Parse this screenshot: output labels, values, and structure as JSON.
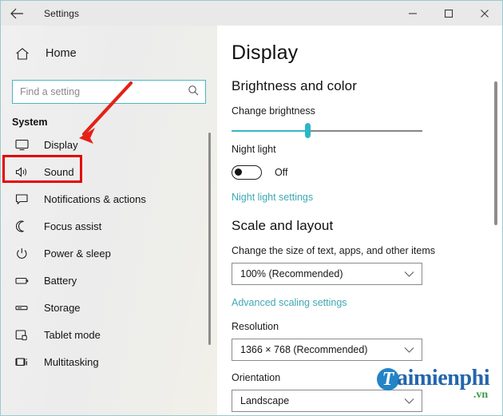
{
  "window": {
    "title": "Settings",
    "back_icon": "back-arrow-icon",
    "minimize_label": "Minimize",
    "maximize_label": "Maximize",
    "close_label": "Close"
  },
  "sidebar": {
    "home": {
      "label": "Home",
      "icon": "home-icon"
    },
    "search": {
      "placeholder": "Find a setting",
      "value": "",
      "icon": "search-icon"
    },
    "group_title": "System",
    "items": [
      {
        "label": "Display",
        "icon": "monitor-icon",
        "selected": true
      },
      {
        "label": "Sound",
        "icon": "speaker-icon",
        "selected": false
      },
      {
        "label": "Notifications & actions",
        "icon": "notification-icon",
        "selected": false
      },
      {
        "label": "Focus assist",
        "icon": "moon-icon",
        "selected": false
      },
      {
        "label": "Power & sleep",
        "icon": "power-icon",
        "selected": false
      },
      {
        "label": "Battery",
        "icon": "battery-icon",
        "selected": false
      },
      {
        "label": "Storage",
        "icon": "storage-icon",
        "selected": false
      },
      {
        "label": "Tablet mode",
        "icon": "tablet-icon",
        "selected": false
      },
      {
        "label": "Multitasking",
        "icon": "multitasking-icon",
        "selected": false
      }
    ]
  },
  "annotation": {
    "highlight_target": "Display",
    "highlight_color": "#e60000",
    "arrow_color": "#e32119"
  },
  "main": {
    "page_title": "Display",
    "brightness_section": {
      "heading": "Brightness and color",
      "slider_label": "Change brightness",
      "slider_percent": 40,
      "night_light_label": "Night light",
      "night_light_state": "Off",
      "night_light_on": false,
      "night_light_link": "Night light settings"
    },
    "scale_section": {
      "heading": "Scale and layout",
      "scale_label": "Change the size of text, apps, and other items",
      "scale_value": "100% (Recommended)",
      "advanced_link": "Advanced scaling settings",
      "resolution_label": "Resolution",
      "resolution_value": "1366 × 768 (Recommended)",
      "orientation_label": "Orientation",
      "orientation_value": "Landscape"
    }
  },
  "watermark": {
    "mark": "T",
    "name": "aimienphi",
    "tld": ".vn"
  },
  "colors": {
    "accent": "#2ab7c8",
    "link": "#3fa8b4",
    "highlight": "#e60000",
    "sidebar_bg": "#eeeeea"
  }
}
